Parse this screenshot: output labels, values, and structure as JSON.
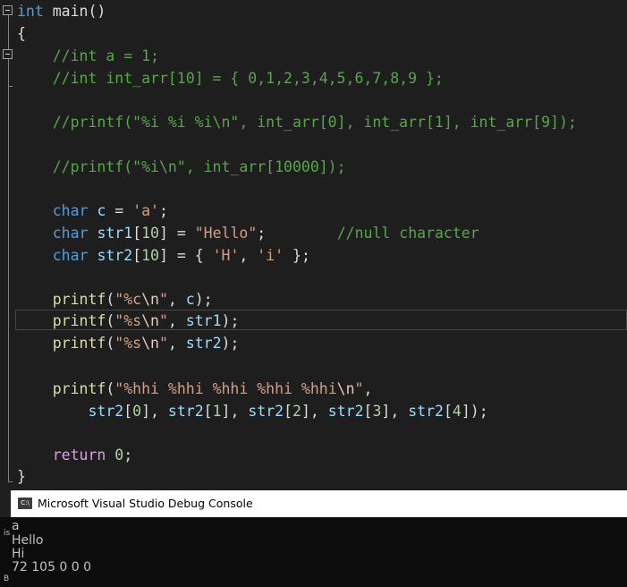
{
  "code": {
    "l1_int": "int",
    "l1_rest": " main()",
    "l2": "{",
    "l3": "    //int a = 1;",
    "l4": "    //int int_arr[10] = { 0,1,2,3,4,5,6,7,8,9 };",
    "l6": "    //printf(\"%i %i %i\\n\", int_arr[0], int_arr[1], int_arr[9]);",
    "l8": "    //printf(\"%i\\n\", int_arr[10000]);",
    "l10_kw": "char",
    "l10_var": "c",
    "l10_eq": " = ",
    "l10_str": "'a'",
    "l10_end": ";",
    "l11_kw": "char",
    "l11_var": "str1",
    "l11_mid": "[",
    "l11_num": "10",
    "l11_mid2": "] = ",
    "l11_str": "\"Hello\"",
    "l11_end": ";",
    "l11_gap": "        ",
    "l11_cm": "//null character",
    "l12_kw": "char",
    "l12_var": "str2",
    "l12_mid": "[",
    "l12_num": "10",
    "l12_mid2": "] = { ",
    "l12_s1": "'H'",
    "l12_comma": ", ",
    "l12_s2": "'i'",
    "l12_end": " };",
    "printf": "printf",
    "l14_q1": "\"%c",
    "l14_esc": "\\n",
    "l14_q2": "\"",
    "l14_args": ", ",
    "l14_var": "c",
    "l14_end": ");",
    "l15_q1": "\"%s",
    "l15_esc": "\\n",
    "l15_q2": "\"",
    "l15_var": "str1",
    "l16_var": "str2",
    "l18_q1": "\"%hhi %hhi %hhi %hhi %hhi",
    "l18_esc": "\\n",
    "l18_q2": "\"",
    "l18_end": ",",
    "l19_a": "str2",
    "l19_i0": "0",
    "l19_i1": "1",
    "l19_i2": "2",
    "l19_i3": "3",
    "l19_i4": "4",
    "return_kw": "return",
    "return_val": "0",
    "close": "}"
  },
  "console": {
    "title": "Microsoft Visual Studio Debug Console",
    "icon_text": "C:\\",
    "lines": [
      "a",
      "Hello",
      "Hi",
      "72 105 0 0 0"
    ]
  },
  "colors": {
    "background": "#1e1e1e",
    "keyword": "#569cd6",
    "comment": "#57a64a",
    "string": "#d69d85",
    "function": "#dcdcaa",
    "variable": "#9cdcfe",
    "number": "#b5cea8",
    "control_keyword": "#d8a0df"
  }
}
